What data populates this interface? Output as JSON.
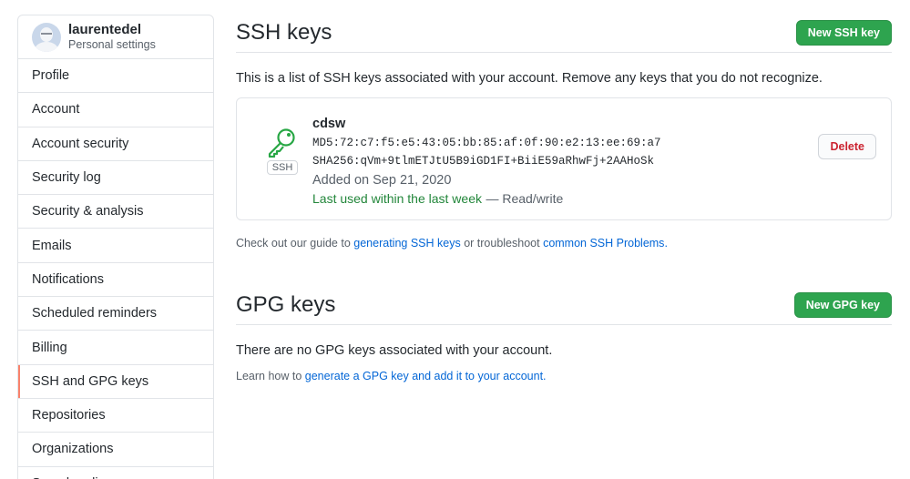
{
  "user": {
    "name": "laurentedel",
    "subtitle": "Personal settings"
  },
  "sidebar": {
    "items": [
      {
        "label": "Profile"
      },
      {
        "label": "Account"
      },
      {
        "label": "Account security"
      },
      {
        "label": "Security log"
      },
      {
        "label": "Security & analysis"
      },
      {
        "label": "Emails"
      },
      {
        "label": "Notifications"
      },
      {
        "label": "Scheduled reminders"
      },
      {
        "label": "Billing"
      },
      {
        "label": "SSH and GPG keys",
        "selected": true
      },
      {
        "label": "Repositories"
      },
      {
        "label": "Organizations"
      },
      {
        "label": "Saved replies"
      }
    ]
  },
  "ssh": {
    "title": "SSH keys",
    "new_button": "New SSH key",
    "description": "This is a list of SSH keys associated with your account. Remove any keys that you do not recognize.",
    "key": {
      "badge": "SSH",
      "name": "cdsw",
      "md5": "MD5:72:c7:f5:e5:43:05:bb:85:af:0f:90:e2:13:ee:69:a7",
      "sha256": "SHA256:qVm+9tlmETJtU5B9iGD1FI+BiiE59aRhwFj+2AAHoSk",
      "added": "Added on Sep 21, 2020",
      "last_used": "Last used within the last week",
      "access": "— Read/write",
      "delete_button": "Delete"
    },
    "guide": {
      "prefix": "Check out our guide to",
      "link1": "generating SSH keys",
      "middle": "or troubleshoot",
      "link2": "common SSH Problems",
      "suffix": "."
    }
  },
  "gpg": {
    "title": "GPG keys",
    "new_button": "New GPG key",
    "empty": "There are no GPG keys associated with your account.",
    "learn": {
      "prefix": "Learn how to",
      "link": "generate a GPG key and add it to your account",
      "suffix": "."
    }
  },
  "colors": {
    "accent_green": "#2ea44f",
    "selected_marker": "#f9826c",
    "link": "#0366d6",
    "danger": "#cb2431",
    "used_green": "#22863a"
  }
}
